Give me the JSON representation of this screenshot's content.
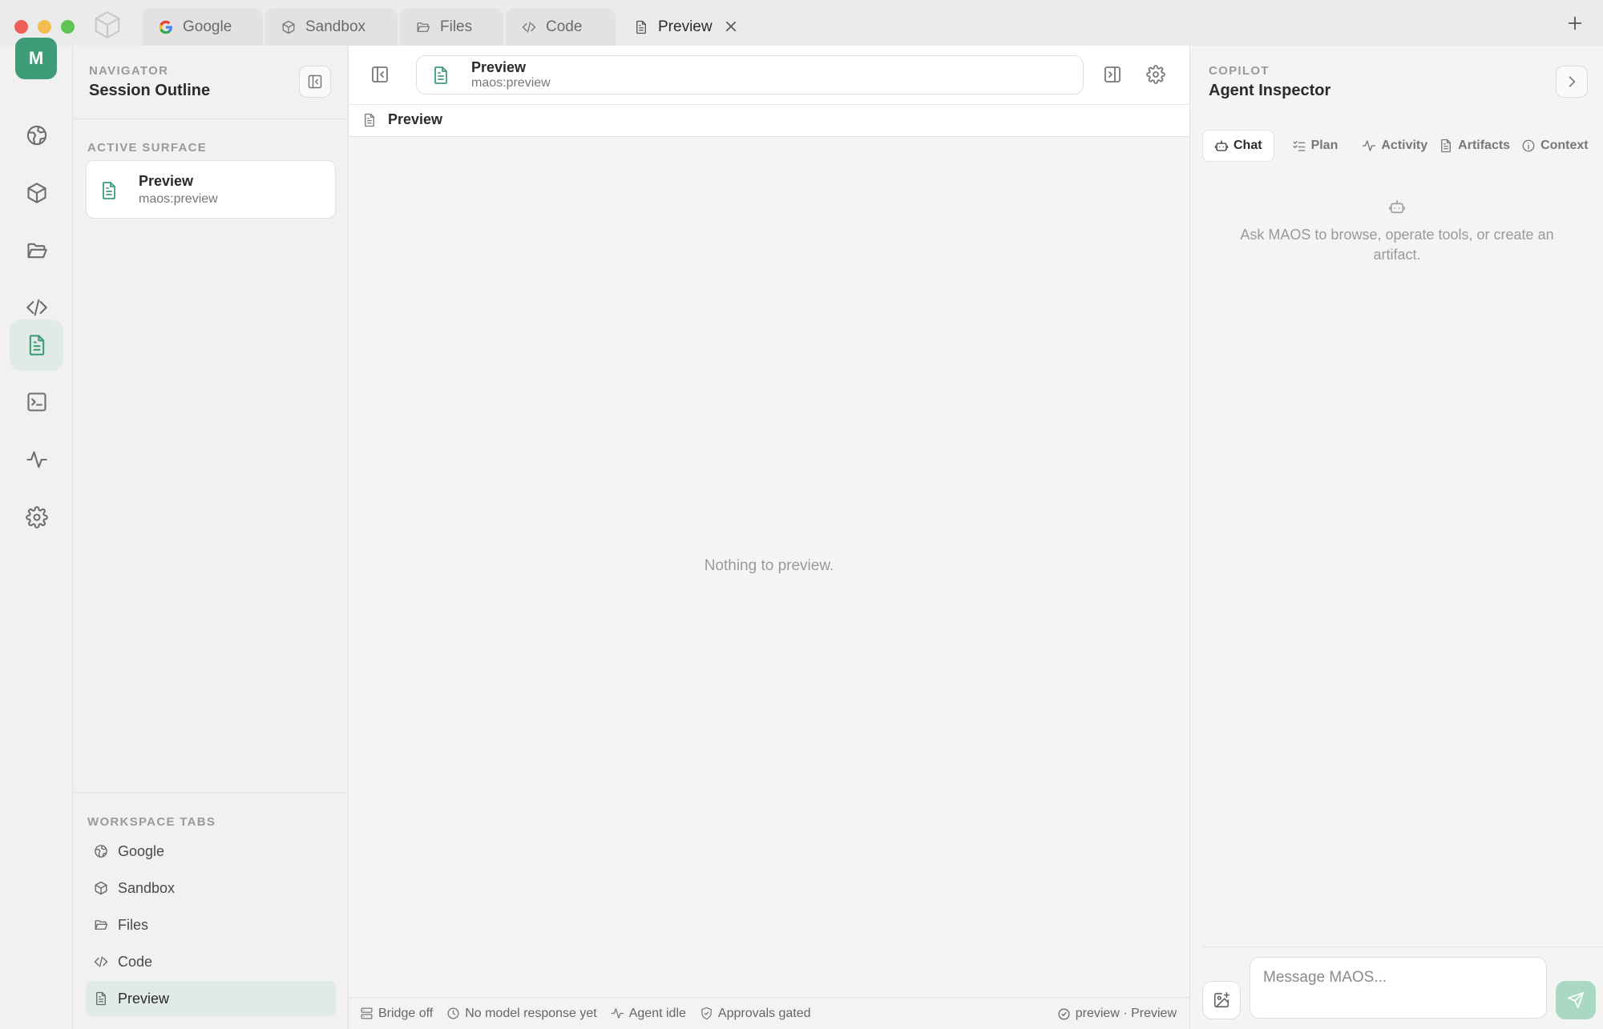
{
  "titlebar": {
    "tabs": [
      {
        "label": "Google",
        "icon": "google-g-icon"
      },
      {
        "label": "Sandbox",
        "icon": "cube-icon"
      },
      {
        "label": "Files",
        "icon": "folder-open-icon"
      },
      {
        "label": "Code",
        "icon": "code-icon"
      },
      {
        "label": "Preview",
        "icon": "document-icon",
        "active": true
      }
    ],
    "new_tab_icon": "plus-icon"
  },
  "rail": {
    "avatar_letter": "M",
    "items": [
      {
        "icon": "globe-icon",
        "target": "Google"
      },
      {
        "icon": "cube-icon",
        "target": "Sandbox"
      },
      {
        "icon": "folder-open-icon",
        "target": "Files"
      },
      {
        "icon": "code-icon",
        "target": "Code"
      },
      {
        "icon": "document-icon",
        "target": "Preview",
        "active": true
      },
      {
        "icon": "terminal-icon"
      },
      {
        "icon": "activity-icon"
      },
      {
        "icon": "gear-icon"
      }
    ]
  },
  "navigator": {
    "eyebrow": "NAVIGATOR",
    "title": "Session Outline",
    "active_surface_label": "ACTIVE SURFACE",
    "active_surface": {
      "title": "Preview",
      "subtitle": "maos:preview"
    },
    "workspace_tabs_label": "WORKSPACE TABS",
    "workspace_tabs": [
      {
        "label": "Google",
        "icon": "globe-icon"
      },
      {
        "label": "Sandbox",
        "icon": "cube-icon"
      },
      {
        "label": "Files",
        "icon": "folder-open-icon"
      },
      {
        "label": "Code",
        "icon": "code-icon"
      },
      {
        "label": "Preview",
        "icon": "document-icon",
        "active": true
      }
    ]
  },
  "main": {
    "address": {
      "title": "Preview",
      "url": "maos:preview"
    },
    "subbar_label": "Preview",
    "empty_message": "Nothing to preview.",
    "status": {
      "bridge": "Bridge off",
      "model": "No model response yet",
      "agent": "Agent idle",
      "approvals": "Approvals gated",
      "right": "preview · Preview"
    }
  },
  "copilot": {
    "eyebrow": "COPILOT",
    "title": "Agent Inspector",
    "tabs": [
      {
        "label": "Chat",
        "icon": "bot-icon",
        "active": true
      },
      {
        "label": "Plan",
        "icon": "list-check-icon"
      },
      {
        "label": "Activity",
        "icon": "activity-icon"
      },
      {
        "label": "Artifacts",
        "icon": "document-icon"
      },
      {
        "label": "Context",
        "icon": "info-icon"
      }
    ],
    "hint": "Ask MAOS to browse, operate tools, or create an artifact.",
    "input_placeholder": "Message MAOS..."
  },
  "colors": {
    "accent": "#3e9d78",
    "accent_soft": "#e1ebe6",
    "send_button": "#a9d9c3",
    "traffic_close": "#ee5f57",
    "traffic_min": "#f4bd4f",
    "traffic_max": "#5fc454"
  }
}
